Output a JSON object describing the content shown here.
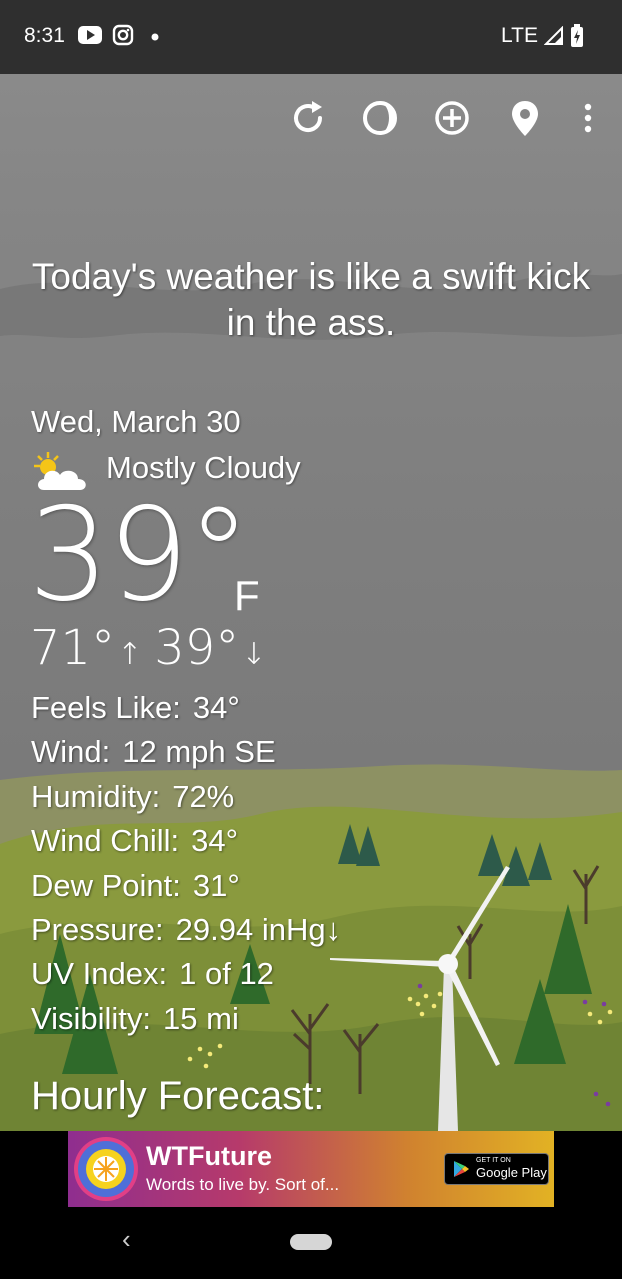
{
  "status_bar": {
    "time": "8:31",
    "network": "LTE"
  },
  "toolbar": {
    "icons": [
      "refresh-icon",
      "moon-phase-icon",
      "add-location-icon",
      "location-pin-icon",
      "more-options-icon"
    ]
  },
  "tagline": "Today's weather is like a swift kick in the ass.",
  "weather": {
    "date": "Wed, March 30",
    "condition": "Mostly Cloudy",
    "condition_icon": "partly-cloudy-icon",
    "temperature": "39°",
    "unit": "F",
    "high": "71°",
    "high_arrow": "↑",
    "low": "39°",
    "low_arrow": "↓"
  },
  "details": [
    {
      "label": "Feels Like:",
      "value": "34°"
    },
    {
      "label": "Wind:",
      "value": "12 mph SE"
    },
    {
      "label": "Humidity:",
      "value": "72%"
    },
    {
      "label": "Wind Chill:",
      "value": "34°"
    },
    {
      "label": "Dew Point:",
      "value": "31°"
    },
    {
      "label": "Pressure:",
      "value": "29.94 inHg↓"
    },
    {
      "label": "UV Index:",
      "value": "1 of 12"
    },
    {
      "label": "Visibility:",
      "value": "15 mi"
    }
  ],
  "hourly_heading": "Hourly Forecast:",
  "ad": {
    "title": "WTFuture",
    "subtitle": "Words to live by.  Sort of...",
    "store_small": "GET IT ON",
    "store_big": "Google Play"
  },
  "colors": {
    "sky": "#808080",
    "hills": "#7f8f3a",
    "trees": "#2f5c2a"
  }
}
